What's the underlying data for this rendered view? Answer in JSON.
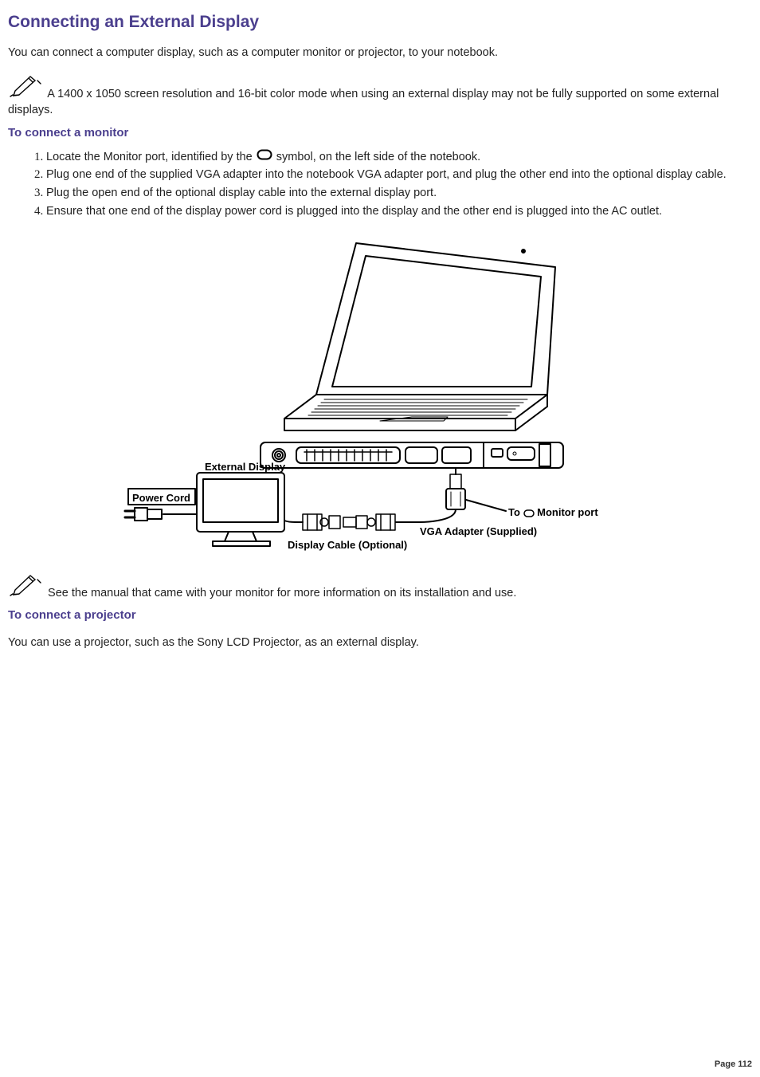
{
  "title": "Connecting an External Display",
  "intro": "You can connect a computer display, such as a computer monitor or projector, to your notebook.",
  "note1": " A 1400 x 1050 screen resolution and 16-bit color mode when using an external display may not be fully supported on some external displays.",
  "heading_monitor": "To connect a monitor",
  "steps": {
    "s1a": "Locate the Monitor port, identified by the ",
    "s1b": " symbol, on the left side of the notebook.",
    "s2": "Plug one end of the supplied VGA adapter into the notebook VGA adapter port, and plug the other end into the optional display cable.",
    "s3": "Plug the open end of the optional display cable into the external display port.",
    "s4": "Ensure that one end of the display power cord is plugged into the display and the other end is plugged into the AC outlet."
  },
  "diagram_labels": {
    "external_display": "External Display",
    "power_cord": "Power Cord",
    "to_monitor_port": "To     Monitor port",
    "vga_adapter": "VGA Adapter (Supplied)",
    "display_cable": "Display Cable (Optional)"
  },
  "note2": " See the manual that came with your monitor for more information on its installation and use.",
  "heading_projector": "To connect a projector",
  "projector_text": "You can use a projector, such as the Sony LCD Projector, as an external display.",
  "page_number": "Page 112"
}
